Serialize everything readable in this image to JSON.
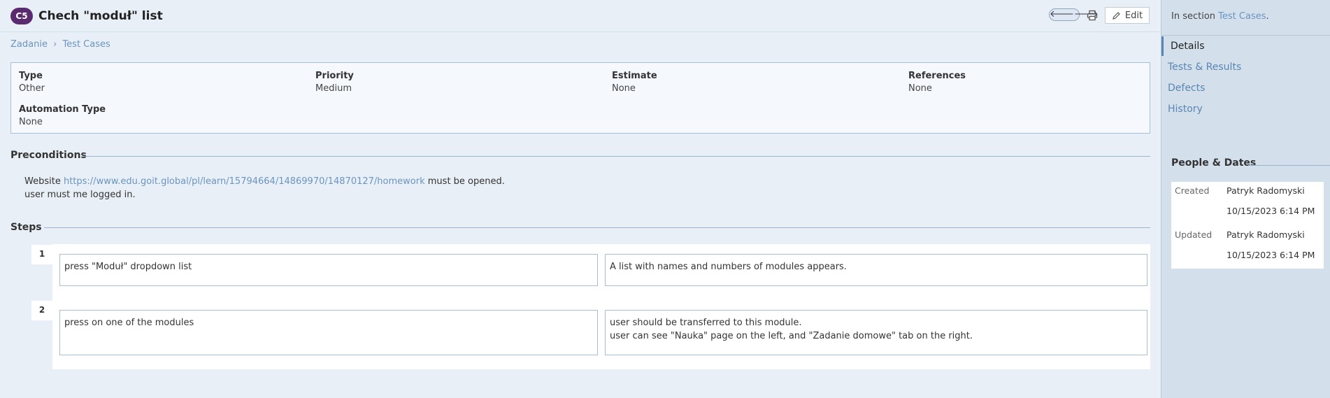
{
  "header": {
    "case_id": "C5",
    "title": "Chech \"moduł\" list",
    "edit_label": "Edit",
    "prev_arrow": "🡐",
    "next_arrow": "🡒"
  },
  "breadcrumb": {
    "parent": "Zadanie",
    "separator": "›",
    "current": "Test Cases"
  },
  "fields": [
    {
      "label": "Type",
      "value": "Other"
    },
    {
      "label": "Priority",
      "value": "Medium"
    },
    {
      "label": "Estimate",
      "value": "None"
    },
    {
      "label": "References",
      "value": "None"
    },
    {
      "label": "Automation Type",
      "value": "None"
    }
  ],
  "preconditions": {
    "title": "Preconditions",
    "website_prefix": "Website",
    "url": "https://www.edu.goit.global/pl/learn/15794664/14869970/14870127/homework",
    "suffix": "must be opened.",
    "line2": "user must me logged in."
  },
  "steps": {
    "title": "Steps",
    "items": [
      {
        "number": "1",
        "action": "press \"Moduł\" dropdown list",
        "expected": [
          "A list with names and numbers of modules appears."
        ]
      },
      {
        "number": "2",
        "action": "press on one of the modules",
        "expected": [
          "user should be transferred to this module.",
          "user can see  \"Nauka\" page on the left, and \"Zadanie domowe\" tab on the right."
        ]
      }
    ]
  },
  "sidebar": {
    "in_section_prefix": "In section",
    "section_link": "Test Cases",
    "in_section_suffix": ".",
    "tabs": [
      "Details",
      "Tests & Results",
      "Defects",
      "History"
    ],
    "active_tab": "Details",
    "people_dates": {
      "title": "People & Dates",
      "created_label": "Created",
      "created_by": "Patryk Radomyski",
      "created_at": "10/15/2023 6:14 PM",
      "updated_label": "Updated",
      "updated_by": "Patryk Radomyski",
      "updated_at": "10/15/2023 6:14 PM"
    }
  },
  "colors": {
    "badge": "#5a2a6e",
    "link": "#6a95c0",
    "sidebar_bg": "#d3e0ec",
    "page_bg": "#e9eff6"
  }
}
